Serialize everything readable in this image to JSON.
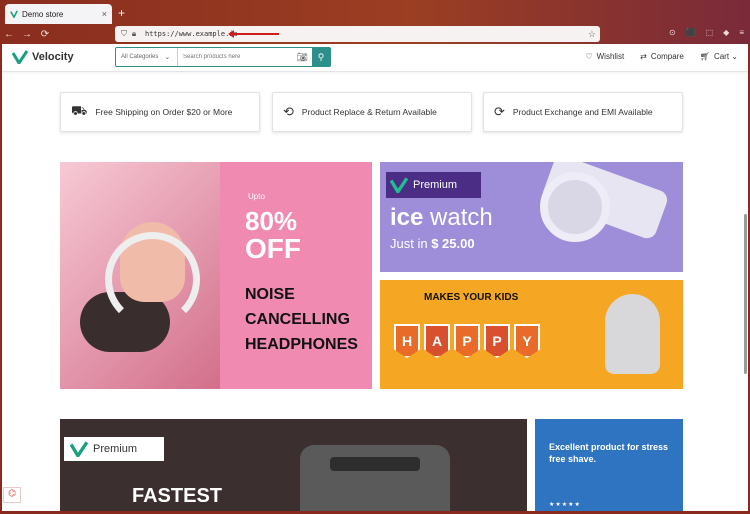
{
  "browser": {
    "tab_title": "Demo store",
    "tab_close": "×",
    "new_tab": "+",
    "nav": {
      "back": "←",
      "forward": "→",
      "reload": "⟳"
    },
    "url": "https://www.example.io",
    "tools": [
      "⊙",
      "⬛",
      "⬚",
      "◆",
      "≡"
    ]
  },
  "header": {
    "brand": "Velocity",
    "category_label": "All Categories",
    "search_placeholder": "Search products here",
    "wishlist": "Wishlist",
    "compare": "Compare",
    "cart": "Cart"
  },
  "features": [
    {
      "icon": "truck-icon",
      "label": "Free Shipping on Order $20 or More"
    },
    {
      "icon": "replace-icon",
      "label": "Product Replace & Return Available"
    },
    {
      "icon": "exchange-icon",
      "label": "Product Exchange and EMI Available"
    }
  ],
  "banners": {
    "headphones": {
      "upto": "Upto",
      "percent": "80%",
      "off": "OFF",
      "line1": "NOISE",
      "line2": "CANCELLING",
      "line3": "HEADPHONES"
    },
    "watch": {
      "tag": "Premium",
      "brand_bold": "ice",
      "brand_rest": " watch",
      "price_prefix": "Just in ",
      "price": "$ 25.00"
    },
    "kids": {
      "headline": "MAKES YOUR KIDS",
      "letters": [
        "H",
        "A",
        "P",
        "P",
        "Y"
      ]
    },
    "toaster": {
      "tag": "Premium",
      "headline": "FASTEST"
    },
    "shave": {
      "text": "Excellent product for stress free shave.",
      "stars": "★★★★★"
    }
  },
  "colors": {
    "accent": "#2c8f8a",
    "pink_banner": "#f08ab0",
    "purple_banner": "#9e8ed9",
    "yellow_banner": "#f5a623",
    "blue_banner": "#2f74c0"
  }
}
